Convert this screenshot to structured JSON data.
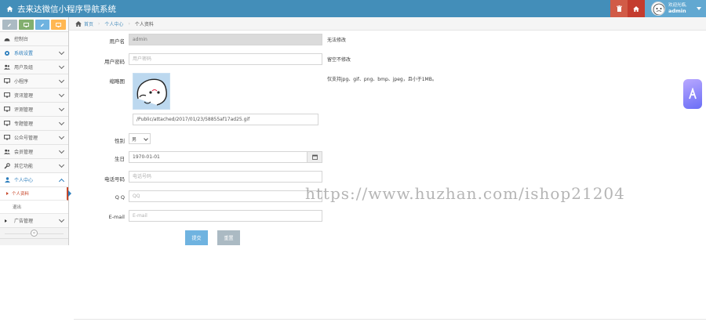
{
  "header": {
    "title": "去来达微信小程序导航系统",
    "welcome": "欢迎光临,",
    "username": "admin"
  },
  "sidebar": {
    "items": [
      {
        "label": "控制台"
      },
      {
        "label": "系统设置"
      },
      {
        "label": "用户及组"
      },
      {
        "label": "小程序"
      },
      {
        "label": "资讯管理"
      },
      {
        "label": "评测管理"
      },
      {
        "label": "专题管理"
      },
      {
        "label": "公众号管理"
      },
      {
        "label": "会员管理"
      },
      {
        "label": "其它功能"
      },
      {
        "label": "个人中心"
      }
    ],
    "sub_items": [
      {
        "label": "个人资料"
      },
      {
        "label": "退出"
      }
    ],
    "ads": {
      "label": "广告管理"
    }
  },
  "breadcrumb": {
    "home": "首页",
    "section": "个人中心",
    "current": "个人资料"
  },
  "form": {
    "username": {
      "label": "用户名",
      "value": "admin",
      "hint": "无法修改"
    },
    "password": {
      "label": "用户密码",
      "placeholder": "用户密码",
      "hint": "留空不修改"
    },
    "thumbnail": {
      "label": "缩略图",
      "path": "/Public/attached/2017/01/23/58855af17ad25.gif",
      "hint": "仅支持jpg、gif、png、bmp、jpeg，且小于1MB。"
    },
    "gender": {
      "label": "性别",
      "value": "男"
    },
    "birthday": {
      "label": "生日",
      "value": "1970-01-01"
    },
    "phone": {
      "label": "电话号码",
      "placeholder": "电话号码"
    },
    "qq": {
      "label": "Q Q",
      "placeholder": "QQ"
    },
    "email": {
      "label": "E-mail",
      "placeholder": "E-mail"
    },
    "submit_label": "提交",
    "reset_label": "重置"
  },
  "watermark": "https://www.huzhan.com/ishop21204"
}
